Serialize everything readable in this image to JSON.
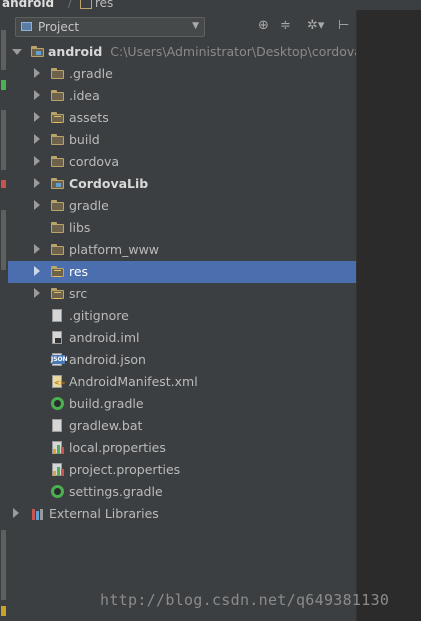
{
  "breadcrumb": {
    "project": "android",
    "folder": "res"
  },
  "header": {
    "view_label": "Project"
  },
  "root": {
    "label": "android",
    "path": "C:\\Users\\Administrator\\Desktop\\cordova"
  },
  "items": [
    {
      "label": ".gradle",
      "icon": "folder-icon"
    },
    {
      "label": ".idea",
      "icon": "folder-icon"
    },
    {
      "label": "assets",
      "icon": "resource-folder-icon"
    },
    {
      "label": "build",
      "icon": "folder-icon"
    },
    {
      "label": "cordova",
      "icon": "folder-icon"
    },
    {
      "label": "CordovaLib",
      "icon": "module-folder-icon"
    },
    {
      "label": "gradle",
      "icon": "folder-icon"
    },
    {
      "label": "libs",
      "icon": "folder-icon"
    },
    {
      "label": "platform_www",
      "icon": "folder-icon"
    },
    {
      "label": "res",
      "icon": "resource-folder-icon"
    },
    {
      "label": "src",
      "icon": "resource-folder-icon"
    },
    {
      "label": ".gitignore",
      "icon": "text-file-icon"
    },
    {
      "label": "android.iml",
      "icon": "iml-file-icon"
    },
    {
      "label": "android.json",
      "icon": "json-file-icon"
    },
    {
      "label": "AndroidManifest.xml",
      "icon": "xml-file-icon"
    },
    {
      "label": "build.gradle",
      "icon": "gradle-file-icon"
    },
    {
      "label": "gradlew.bat",
      "icon": "text-file-icon"
    },
    {
      "label": "local.properties",
      "icon": "properties-file-icon"
    },
    {
      "label": "project.properties",
      "icon": "properties-file-icon"
    },
    {
      "label": "settings.gradle",
      "icon": "gradle-file-icon"
    }
  ],
  "external": {
    "label": "External Libraries"
  },
  "watermark": "http://blog.csdn.net/q649381130",
  "colors": {
    "selection": "#4b6eaf",
    "panel": "#3c3f41",
    "editor": "#2b2b2b",
    "folder": "#b9a56a",
    "gradle": "#4caf50"
  }
}
